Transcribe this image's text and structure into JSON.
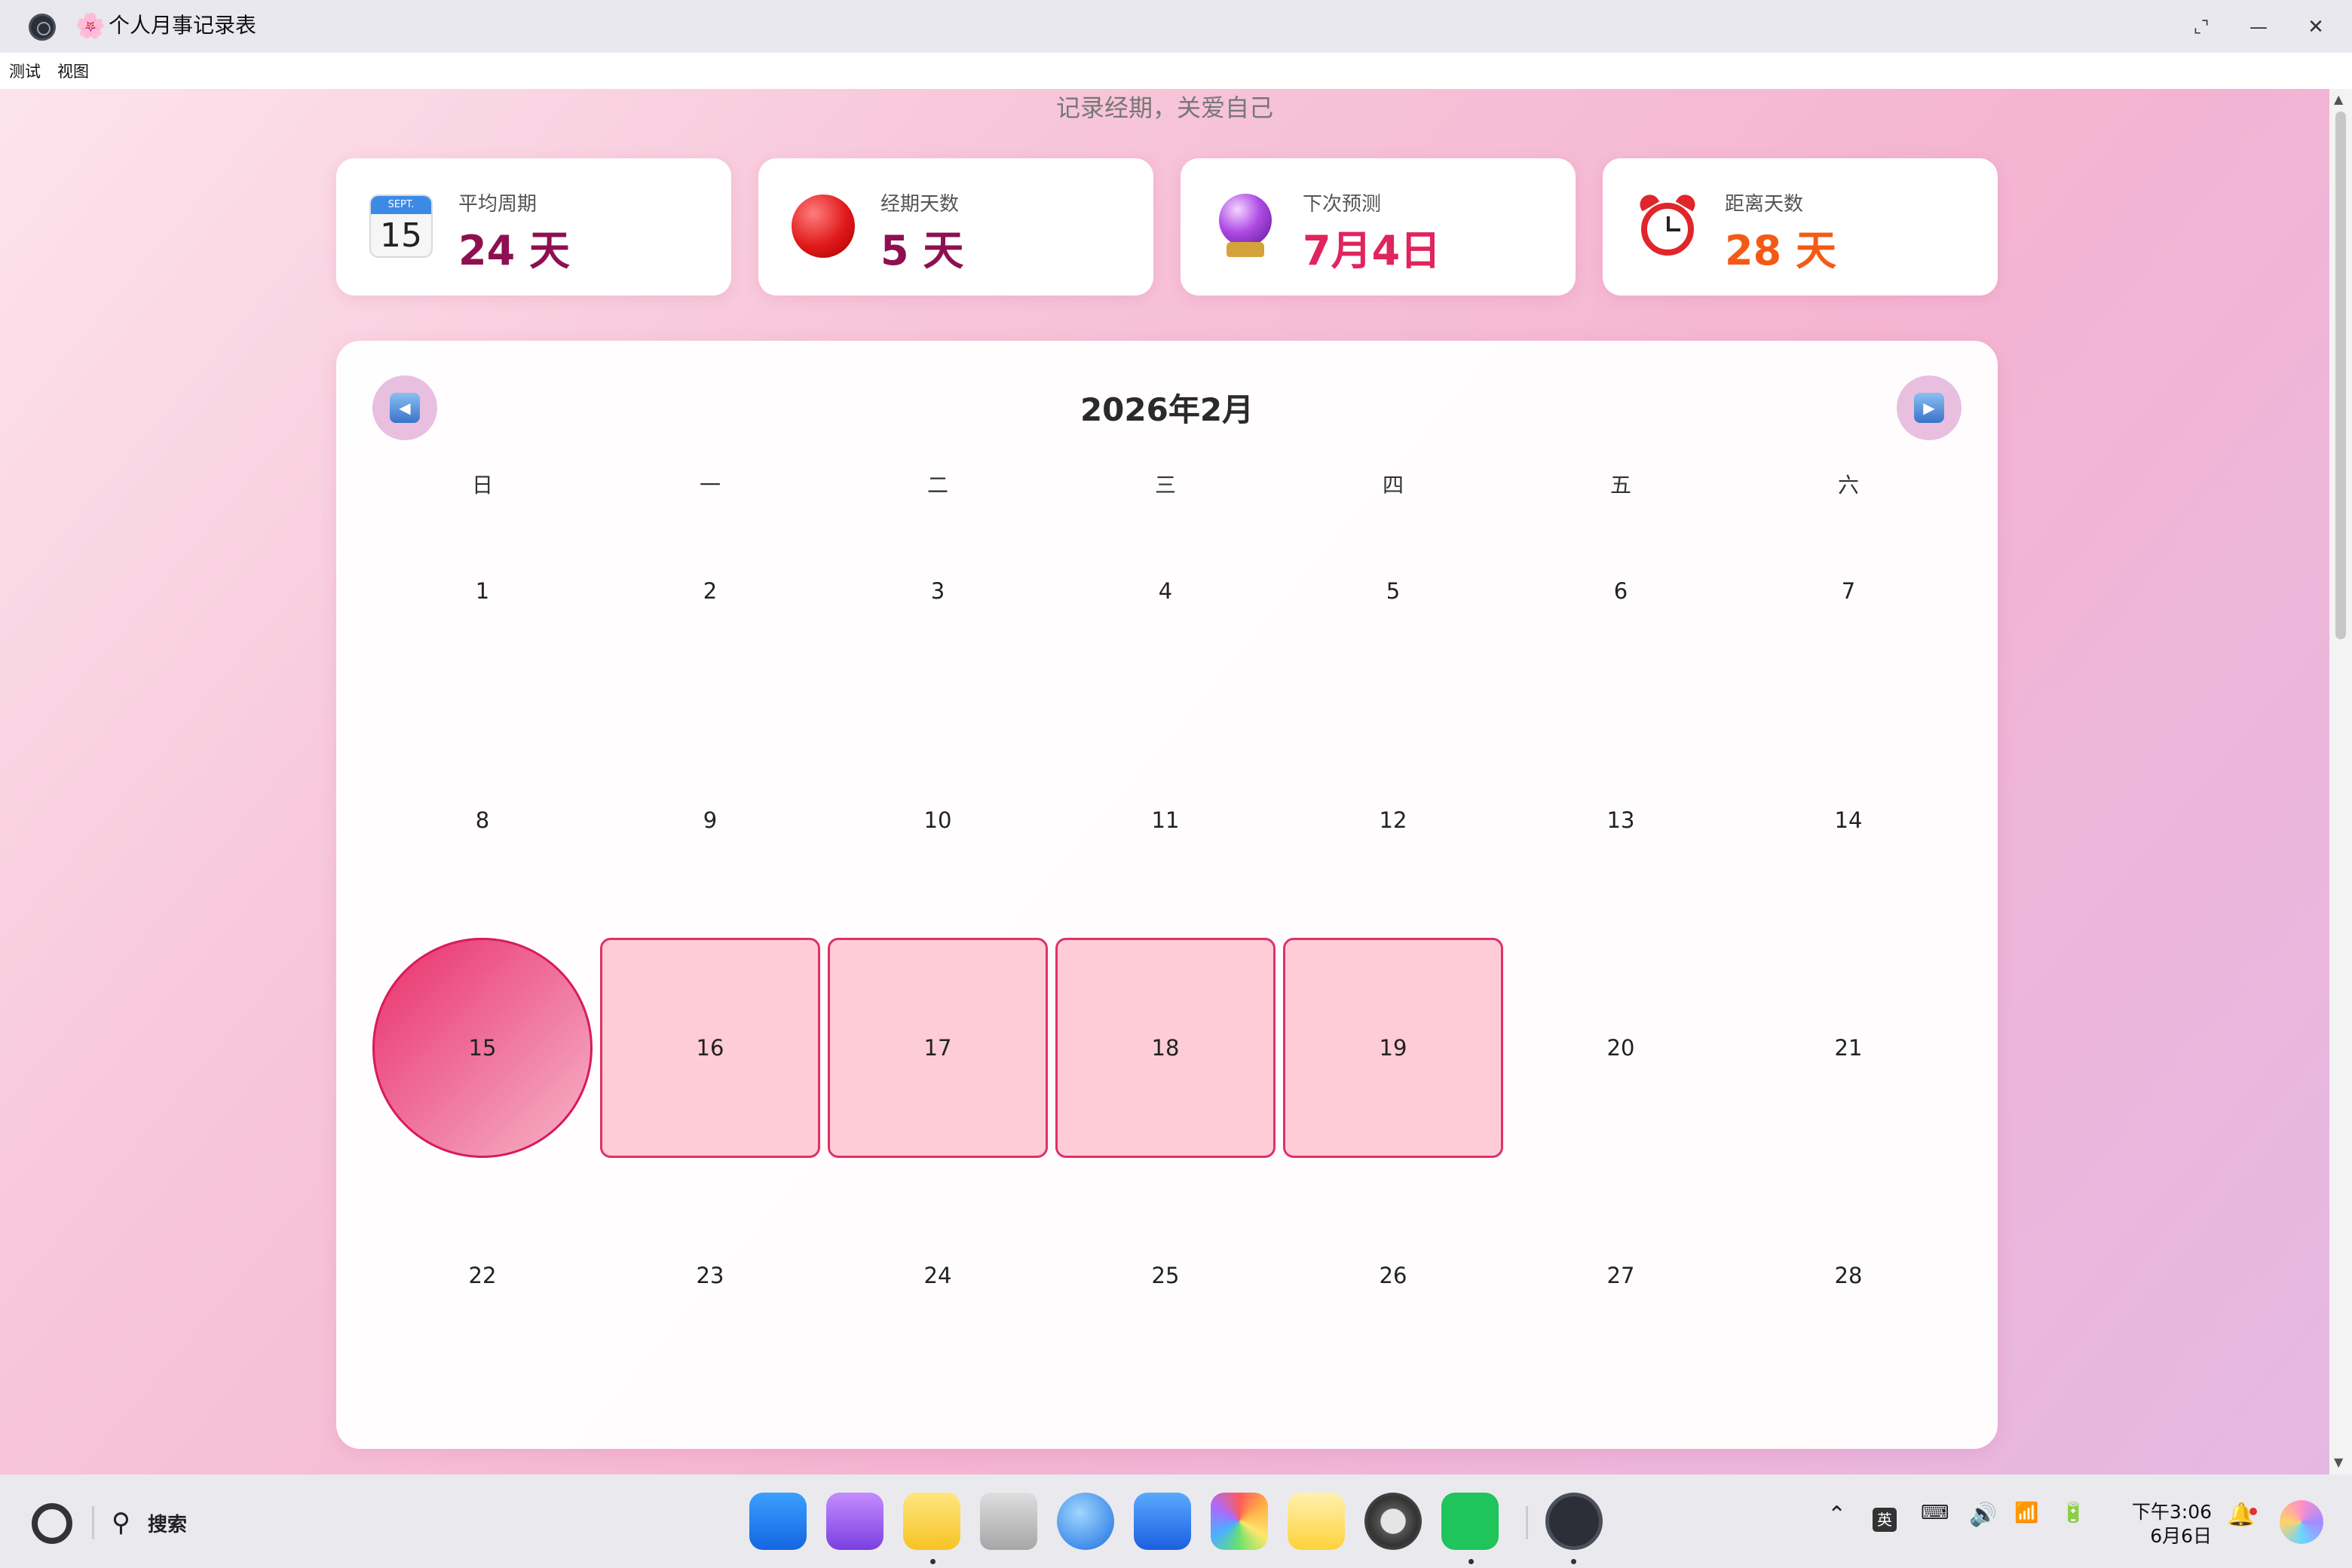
{
  "window": {
    "title": "个人月事记录表",
    "title_emoji": "🌸",
    "controls": {
      "restore": "⌞⌝",
      "minimize": "—",
      "close": "✕"
    }
  },
  "menu": {
    "items": [
      "测试",
      "视图"
    ]
  },
  "app": {
    "subtitle": "记录经期，关爱自己",
    "stats": [
      {
        "label": "平均周期",
        "value": "24 天",
        "icon": "calendar-icon",
        "icon_text_month": "SEPT.",
        "icon_text_day": "15",
        "color": "#8e1050"
      },
      {
        "label": "经期天数",
        "value": "5 天",
        "icon": "red-circle-icon",
        "color": "#8e1050"
      },
      {
        "label": "下次预测",
        "value": "7月4日",
        "icon": "crystal-ball-icon",
        "color": "#e0245e"
      },
      {
        "label": "距离天数",
        "value": "28 天",
        "icon": "alarm-clock-icon",
        "color": "#f45a16"
      }
    ]
  },
  "calendar": {
    "month_title": "2026年2月",
    "prev_label": "◀",
    "next_label": "▶",
    "weekdays": [
      "日",
      "一",
      "二",
      "三",
      "四",
      "五",
      "六"
    ],
    "weeks": [
      [
        "1",
        "2",
        "3",
        "4",
        "5",
        "6",
        "7"
      ],
      [
        "8",
        "9",
        "10",
        "11",
        "12",
        "13",
        "14"
      ],
      [
        "15",
        "16",
        "17",
        "18",
        "19",
        "20",
        "21"
      ],
      [
        "22",
        "23",
        "24",
        "25",
        "26",
        "27",
        "28"
      ]
    ],
    "period_start_day": "15",
    "period_days": [
      "16",
      "17",
      "18",
      "19"
    ]
  },
  "taskbar": {
    "search_label": "搜索",
    "apps": [
      "app-launcher-icon",
      "multitask-icon",
      "files-icon",
      "trash-icon",
      "browser-icon",
      "mail-icon",
      "gallery-icon",
      "notes-icon",
      "settings-icon",
      "wechat-icon",
      "electron-app-icon"
    ],
    "ime_label": "英",
    "time": "下午3:06",
    "date": "6月6日"
  }
}
